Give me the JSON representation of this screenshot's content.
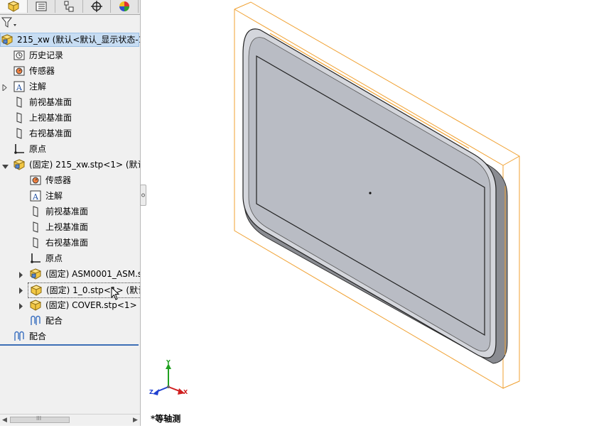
{
  "feature_manager": {
    "tabs": [
      {
        "name": "featuremanager-tab",
        "icon": "assembly-icon"
      },
      {
        "name": "propertymanager-tab",
        "icon": "property-list-icon"
      },
      {
        "name": "configuration-tab",
        "icon": "configuration-icon"
      },
      {
        "name": "dimxpert-tab",
        "icon": "crosshair-icon"
      },
      {
        "name": "display-manager-tab",
        "icon": "color-wheel-icon"
      }
    ],
    "filter_icon": "filter-icon",
    "tree": {
      "root": "215_xw  (默认<默认_显示状态-1",
      "history": "历史记录",
      "sensors": "传感器",
      "annotations": "注解",
      "front_plane": "前视基准面",
      "top_plane": "上视基准面",
      "right_plane": "右视基准面",
      "origin": "原点",
      "sub_assembly": "(固定) 215_xw.stp<1> (默认",
      "sub_sensors": "传感器",
      "sub_annotations": "注解",
      "sub_front_plane": "前视基准面",
      "sub_top_plane": "上视基准面",
      "sub_right_plane": "右视基准面",
      "sub_origin": "原点",
      "asm0001": "(固定) ASM0001_ASM.s",
      "part_1_0": "(固定) 1_0.stp<1> (默认",
      "cover": "(固定) COVER.stp<1> (",
      "sub_mates": "配合",
      "mates": "配合"
    },
    "scrollbar": {
      "thumb_grip": "III"
    }
  },
  "viewport": {
    "view_orientation": "*等轴测",
    "triad_axes": [
      "X",
      "Y",
      "Z"
    ],
    "colors": {
      "bounding_box": "#f0a030",
      "panel_face": "#b9bcc4",
      "frame": "#d4d6dc",
      "selection": "#c7ddf3",
      "triad_x": "#d02020",
      "triad_y": "#20a020",
      "triad_z": "#2040d0"
    }
  }
}
